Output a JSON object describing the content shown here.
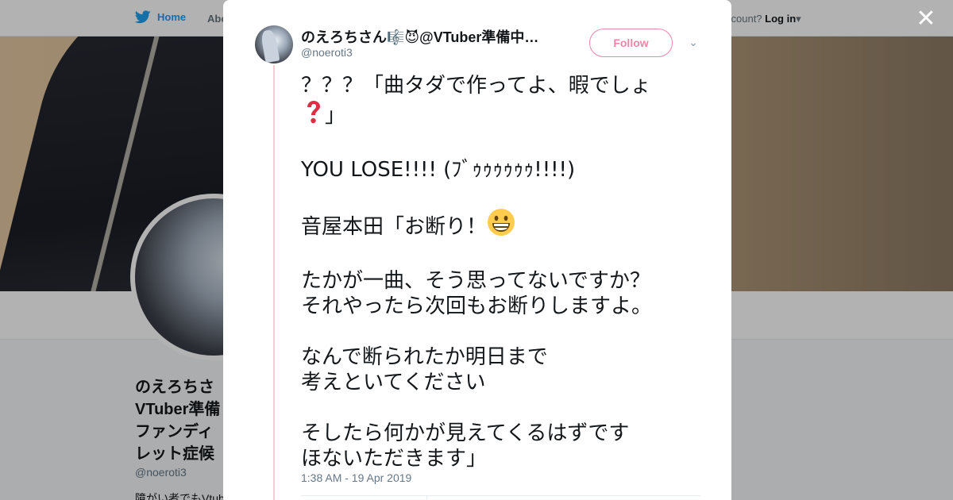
{
  "nav": {
    "home_label": "Home",
    "about_label": "Abo",
    "account_prompt": "ccount?",
    "login_label": "Log in"
  },
  "profile": {
    "name_lines": [
      "のえろちさ",
      "VTuber準備",
      "ファンディ",
      "レット症候"
    ],
    "handle": "@noeroti3",
    "bio": "障がい者でもVtub"
  },
  "tweet": {
    "display_name": "のえろちさん🎼😈@VTuber準備中…",
    "handle": "@noeroti3",
    "follow_label": "Follow",
    "caret": "⌄",
    "lines": [
      "？？？「曲タダで作ってよ、暇でしょ",
      "」",
      "",
      "YOU LOSE!!!! (ﾌﾞｩｩｩｩｩｩ!!!!)",
      "",
      "音屋本田「お断り！",
      "",
      "たかが一曲、そう思ってないですか？",
      "それやったら次回もお断りしますよ。",
      "",
      "なんで断られたか明日まで",
      "考えといてください",
      "",
      "そしたら何かが見えてくるはずです",
      "ほないただきます」"
    ],
    "timestamp": "1:38 AM - 19 Apr 2019"
  },
  "icons": {
    "twitter_bird": "twitter-bird-icon",
    "close": "close-icon",
    "question_emoji": "red-question-mark-icon",
    "grin_emoji": "grinning-face-icon"
  },
  "colors": {
    "brand": "#1da1f2",
    "accent": "#e0245e",
    "thread": "#f7cad6",
    "muted": "#657786"
  },
  "close_glyph": "✕"
}
